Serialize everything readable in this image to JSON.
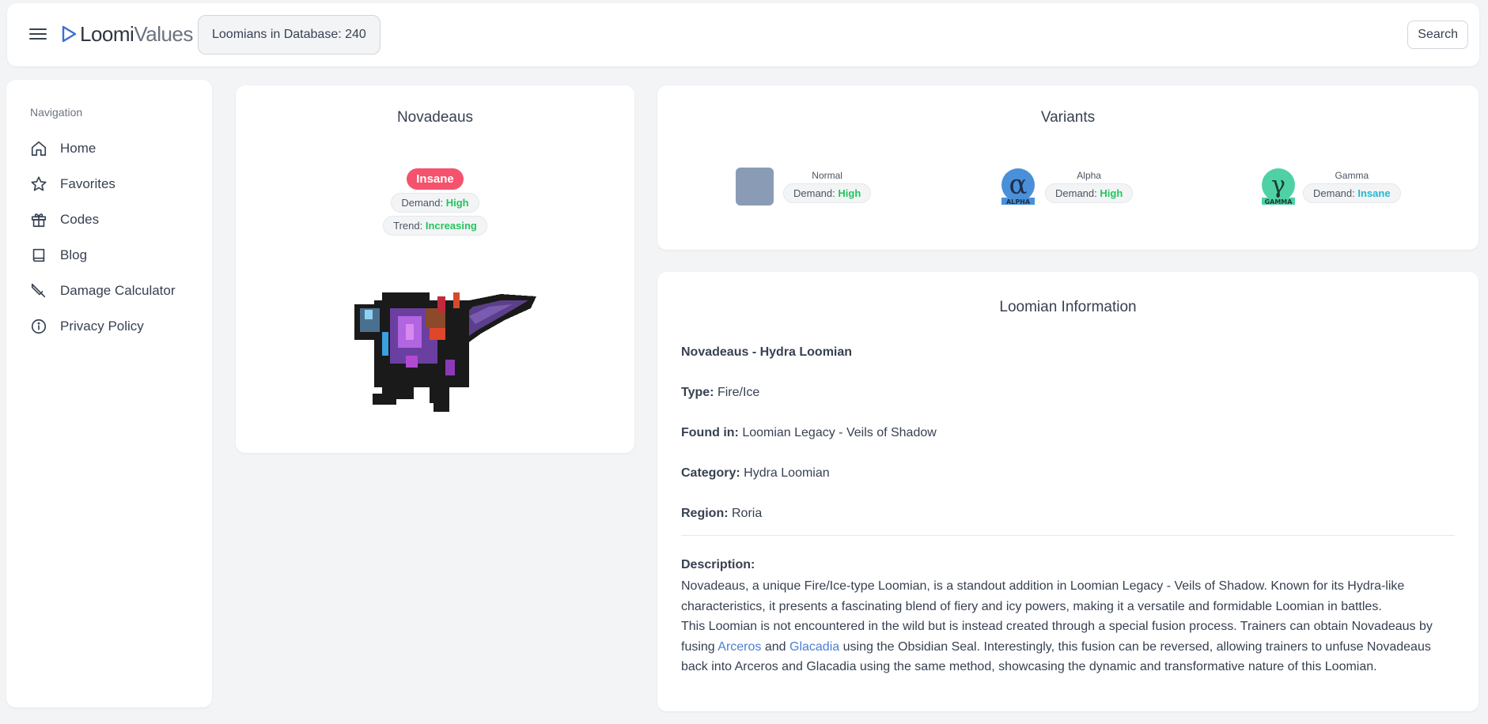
{
  "header": {
    "logo_bold": "Loomi",
    "logo_light": "Values",
    "db_count_label": "Loomians in Database: 240",
    "search_label": "Search"
  },
  "sidebar": {
    "title": "Navigation",
    "items": [
      {
        "label": "Home",
        "icon": "home-icon"
      },
      {
        "label": "Favorites",
        "icon": "star-icon"
      },
      {
        "label": "Codes",
        "icon": "gift-icon"
      },
      {
        "label": "Blog",
        "icon": "book-icon"
      },
      {
        "label": "Damage Calculator",
        "icon": "sword-icon"
      },
      {
        "label": "Privacy Policy",
        "icon": "info-icon"
      }
    ]
  },
  "loomian": {
    "name": "Novadeaus",
    "value_tier": "Insane",
    "demand_label": "Demand:",
    "demand_value": "High",
    "trend_label": "Trend:",
    "trend_value": "Increasing"
  },
  "variants": {
    "title": "Variants",
    "items": [
      {
        "name": "Normal",
        "demand_label": "Demand:",
        "demand_value": "High"
      },
      {
        "name": "Alpha",
        "demand_label": "Demand:",
        "demand_value": "High",
        "symbol": "α",
        "caption": "ALPHA"
      },
      {
        "name": "Gamma",
        "demand_label": "Demand:",
        "demand_value": "Insane",
        "symbol": "γ",
        "caption": "GAMMA"
      }
    ]
  },
  "info": {
    "title": "Loomian Information",
    "heading": "Novadeaus - Hydra Loomian",
    "type_label": "Type:",
    "type_value": "Fire/Ice",
    "found_label": "Found in:",
    "found_value": "Loomian Legacy - Veils of Shadow",
    "category_label": "Category:",
    "category_value": "Hydra Loomian",
    "region_label": "Region:",
    "region_value": "Roria",
    "desc_label": "Description:",
    "desc_p1": "Novadeaus, a unique Fire/Ice-type Loomian, is a standout addition in Loomian Legacy - Veils of Shadow. Known for its Hydra-like characteristics, it presents a fascinating blend of fiery and icy powers, making it a versatile and formidable Loomian in battles.",
    "desc_p2_a": "This Loomian is not encountered in the wild but is instead created through a special fusion process. Trainers can obtain Novadeaus by fusing",
    "desc_link1": "Arceros",
    "desc_and": "and",
    "desc_link2": "Glacadia",
    "desc_p2_b": "using the Obsidian Seal. Interestingly, this fusion can be reversed, allowing trainers to unfuse Novadeaus back into Arceros and Glacadia using the same method, showcasing the dynamic and transformative nature of this Loomian."
  },
  "colors": {
    "insane_badge": "#f4526d",
    "demand_high": "#22c55e",
    "demand_insane": "#22b8cf",
    "link": "#4a7fd4",
    "normal_variant": "#8a9bb5",
    "alpha_variant": "#4a90d9",
    "gamma_variant": "#4fd1a5"
  }
}
